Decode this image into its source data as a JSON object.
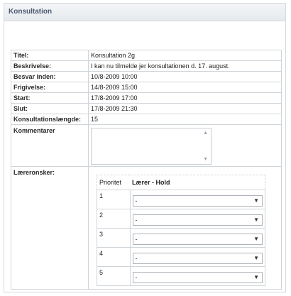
{
  "panel": {
    "title": "Konsultation"
  },
  "details": [
    {
      "label": "Titel:",
      "value": "Konsultation 2g"
    },
    {
      "label": "Beskrivelse:",
      "value": "I kan nu tilmelde jer konsultationen d. 17. august."
    },
    {
      "label": "Besvar inden:",
      "value": "10/8-2009 10:00"
    },
    {
      "label": "Frigivelse:",
      "value": "14/8-2009 15:00"
    },
    {
      "label": "Start:",
      "value": "17/8-2009 17:00"
    },
    {
      "label": "Slut:",
      "value": "17/8-2009 21:30"
    },
    {
      "label": "Konsultationslængde:",
      "value": "15"
    }
  ],
  "comments": {
    "label": "Kommentarer",
    "value": ""
  },
  "wishes": {
    "label": "Læreronsker:",
    "col_priority": "Prioritet",
    "col_teacher": "Lærer - Hold",
    "rows": [
      {
        "priority": "1",
        "selected": "-"
      },
      {
        "priority": "2",
        "selected": "-"
      },
      {
        "priority": "3",
        "selected": "-"
      },
      {
        "priority": "4",
        "selected": "-"
      },
      {
        "priority": "5",
        "selected": "-"
      }
    ]
  },
  "icons": {
    "dropdown": "chevron-down-icon",
    "scroll_up": "scroll-up-icon",
    "scroll_down": "scroll-down-icon"
  }
}
